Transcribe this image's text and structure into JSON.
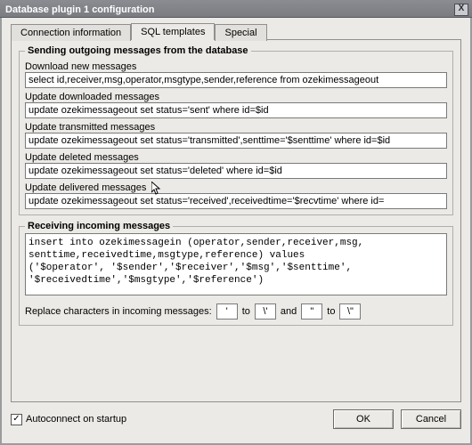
{
  "window": {
    "title": "Database plugin 1 configuration",
    "close": "X"
  },
  "tabs": {
    "connection": "Connection information",
    "sql": "SQL templates",
    "special": "Special"
  },
  "outgoing": {
    "legend": "Sending outgoing messages from the database",
    "download_label": "Download new messages",
    "download_sql": "select id,receiver,msg,operator,msgtype,sender,reference from ozekimessageout",
    "updated_label": "Update downloaded messages",
    "updated_sql": "update ozekimessageout set status='sent' where id=$id",
    "transmitted_label": "Update transmitted messages",
    "transmitted_sql": "update ozekimessageout set status='transmitted',senttime='$senttime' where id=$id",
    "deleted_label": "Update deleted messages",
    "deleted_sql": "update ozekimessageout set status='deleted' where id=$id",
    "delivered_label": "Update delivered messages",
    "delivered_sql": "update ozekimessageout set status='received',receivedtime='$recvtime' where id="
  },
  "incoming": {
    "legend": "Receiving incoming messages",
    "sql": "insert into ozekimessagein (operator,sender,receiver,msg,\nsenttime,receivedtime,msgtype,reference) values\n('$operator', '$sender','$receiver','$msg','$senttime',\n'$receivedtime','$msgtype','$reference')",
    "replace_label": "Replace characters in incoming messages:",
    "to": "to",
    "and": "and",
    "r1a": "'",
    "r1b": "\\'",
    "r2a": "\"",
    "r2b": "\\\""
  },
  "footer": {
    "autoconnect": "Autoconnect on startup",
    "ok": "OK",
    "cancel": "Cancel"
  }
}
